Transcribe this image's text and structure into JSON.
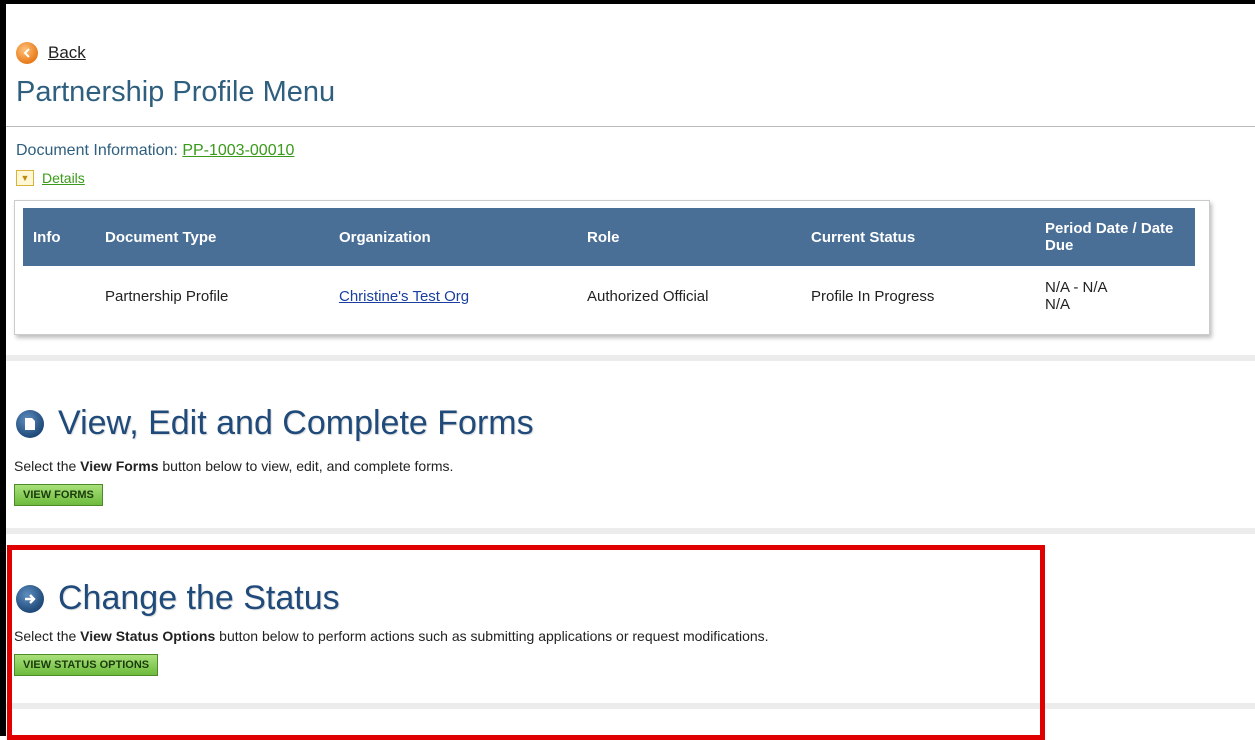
{
  "back": {
    "label": "Back",
    "icon": "back-arrow-icon"
  },
  "page_title": "Partnership Profile Menu",
  "document_info": {
    "label": "Document Information:",
    "doc_id": "PP-1003-00010"
  },
  "details": {
    "label": "Details",
    "icon": "chevron-down-icon"
  },
  "table": {
    "headers": [
      "Info",
      "Document Type",
      "Organization",
      "Role",
      "Current Status",
      "Period Date / Date Due"
    ],
    "row": {
      "info": "",
      "document_type": "Partnership Profile",
      "organization": "Christine's Test Org",
      "role": "Authorized Official",
      "current_status": "Profile In Progress",
      "period_date": "N/A - N/A",
      "date_due": "N/A"
    }
  },
  "forms_section": {
    "icon": "document-icon",
    "title": "View, Edit and Complete Forms",
    "desc_prefix": "Select the ",
    "desc_bold": "View Forms",
    "desc_suffix": " button below to view, edit, and complete forms.",
    "button": "VIEW FORMS"
  },
  "status_section": {
    "icon": "arrow-right-icon",
    "title": "Change the Status",
    "desc_prefix": "Select the ",
    "desc_bold": "View Status Options",
    "desc_suffix": " button below to perform actions such as submitting applications or request modifications.",
    "button": "VIEW STATUS OPTIONS"
  },
  "colors": {
    "title_blue": "#2f5f7f",
    "header_blue": "#4a6f96",
    "link_green": "#3a9a1a",
    "button_green": "#6cbb3c",
    "highlight_red": "#e00000"
  }
}
